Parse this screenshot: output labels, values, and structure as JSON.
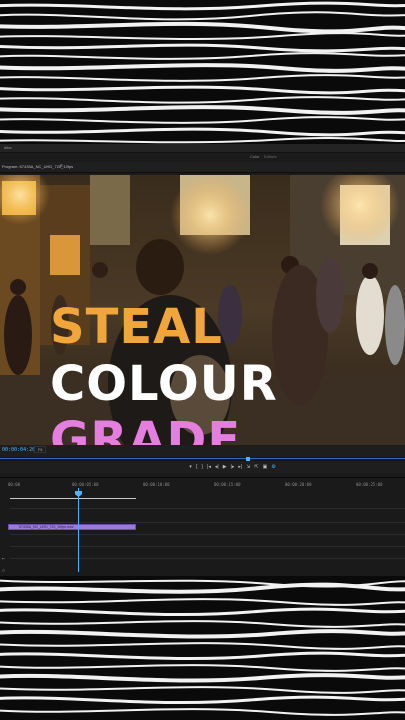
{
  "menubar": {
    "title": "ditor",
    "workspace_tabs": [
      "Color",
      "Editors"
    ]
  },
  "program_monitor": {
    "tab_label": "Program: 67435A_NC_UHD_720_10fps",
    "close_glyph": "≡"
  },
  "overlay_title": {
    "line1": "STEAL",
    "line2": "COLOUR",
    "line3": "GRADE",
    "colors": {
      "line1": "#f0a63a",
      "line2": "#ffffff",
      "line3": "#e47fe0"
    }
  },
  "viewer_controls": {
    "timecode": "00:00:04:20",
    "fit_value": "Fit"
  },
  "transport_icons": [
    "marker-icon",
    "in-point-icon",
    "out-point-icon",
    "go-to-in-icon",
    "step-back-icon",
    "play-icon",
    "step-forward-icon",
    "go-to-out-icon",
    "insert-icon",
    "overwrite-icon",
    "export-frame-icon",
    "settings-icon"
  ],
  "timeline": {
    "ruler_labels": [
      "00:00",
      "00:00:05:00",
      "00:00:10:00",
      "00:00:15:00",
      "00:00:20:00",
      "00:00:25:00"
    ],
    "clip_name": "67435A_NC_UHD_720_10fps.mov",
    "clip_color": "#9b7bd6",
    "playhead_color": "#4fb1ff"
  }
}
